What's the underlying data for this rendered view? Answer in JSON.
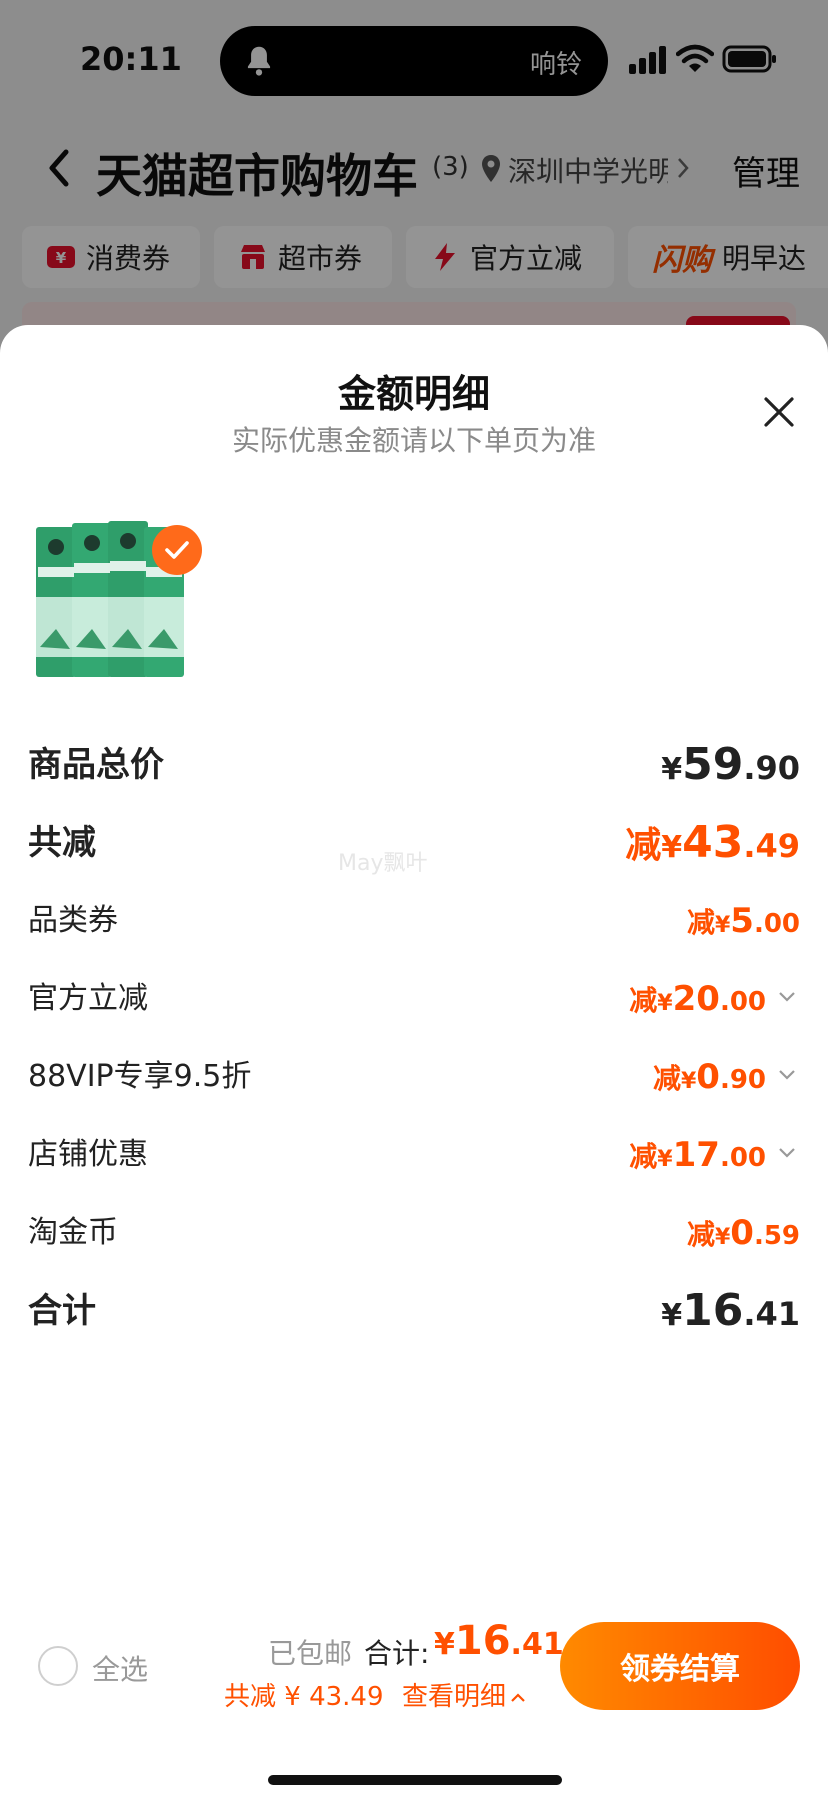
{
  "status_bar": {
    "time": "20:11",
    "ring_label": "响铃"
  },
  "nav": {
    "title": "天猫超市购物车",
    "count": "(3)",
    "location": "深圳中学光明",
    "manage": "管理"
  },
  "chips": [
    {
      "label": "消费券",
      "icon": "coupon-icon"
    },
    {
      "label": "超市券",
      "icon": "store-icon"
    },
    {
      "label": "官方立减",
      "icon": "lightning-icon"
    },
    {
      "logo": "闪购",
      "label": "明早达"
    }
  ],
  "colors": {
    "accent": "#ff5000",
    "text": "#222222",
    "muted": "#8a8a8a"
  },
  "sheet": {
    "title": "金额明细",
    "subtitle": "实际优惠金额请以下单页为准",
    "watermark": "May飘叶"
  },
  "breakdown": {
    "subtotal": {
      "label": "商品总价",
      "cur": "¥",
      "int": "59",
      "dec": ".90"
    },
    "total_saved": {
      "label": "共减",
      "prefix": "减",
      "cur": "¥",
      "int": "43",
      "dec": ".49"
    },
    "items": [
      {
        "label": "品类券",
        "prefix": "减",
        "cur": "¥",
        "int": "5",
        "dec": ".00"
      },
      {
        "label": "官方立减",
        "prefix": "减",
        "cur": "¥",
        "int": "20",
        "dec": ".00"
      },
      {
        "label": "88VIP专享9.5折",
        "prefix": "减",
        "cur": "¥",
        "int": "0",
        "dec": ".90"
      },
      {
        "label": "店铺优惠",
        "prefix": "减",
        "cur": "¥",
        "int": "17",
        "dec": ".00"
      },
      {
        "label": "淘金币",
        "prefix": "减",
        "cur": "¥",
        "int": "0",
        "dec": ".59"
      }
    ],
    "total": {
      "label": "合计",
      "cur": "¥",
      "int": "16",
      "dec": ".41"
    }
  },
  "bottom_bar": {
    "select_all": "全选",
    "shipping": "已包邮",
    "total_label": "合计:",
    "total_cur": "¥",
    "total_int": "16",
    "total_dec": ".41",
    "saved": "共减 ¥ 43.49",
    "detail_link": "查看明细",
    "checkout": "领券结算"
  }
}
